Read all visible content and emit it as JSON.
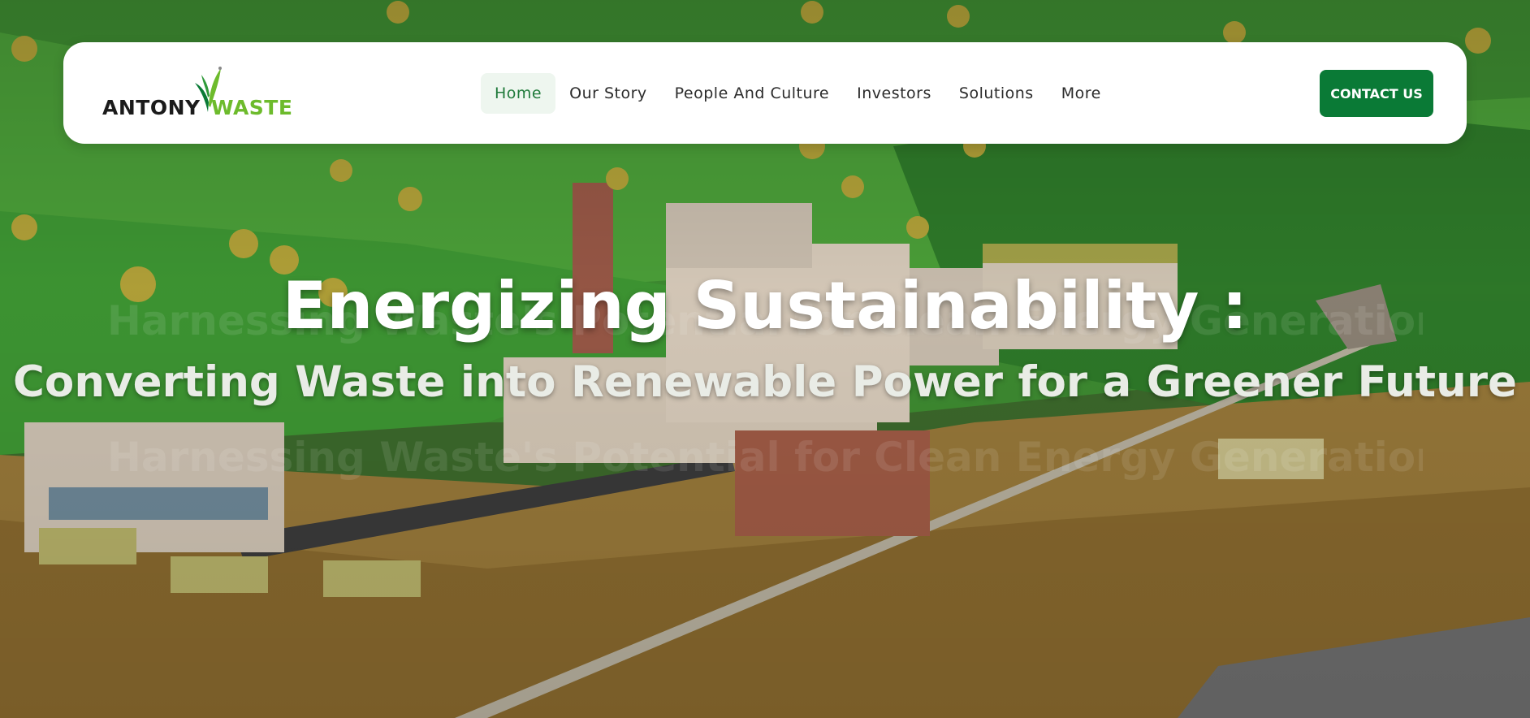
{
  "brand": {
    "name_dark": "ANTONY",
    "name_green": "WASTE",
    "colors": {
      "primary_green": "#0a7a36",
      "logo_green": "#6dbb2c",
      "active_bg": "#eef6ef"
    }
  },
  "nav": {
    "items": [
      {
        "label": "Home",
        "active": true
      },
      {
        "label": "Our Story"
      },
      {
        "label": "People And Culture"
      },
      {
        "label": "Investors"
      },
      {
        "label": "Solutions"
      },
      {
        "label": "More"
      }
    ],
    "contact_label": "CONTACT US"
  },
  "hero": {
    "title": "Energizing Sustainability :",
    "subtitle": "Converting Waste into Renewable Power for a Greener Future",
    "rotating_text": "Harnessing Waste's Potential for Clean Energy Generation"
  }
}
